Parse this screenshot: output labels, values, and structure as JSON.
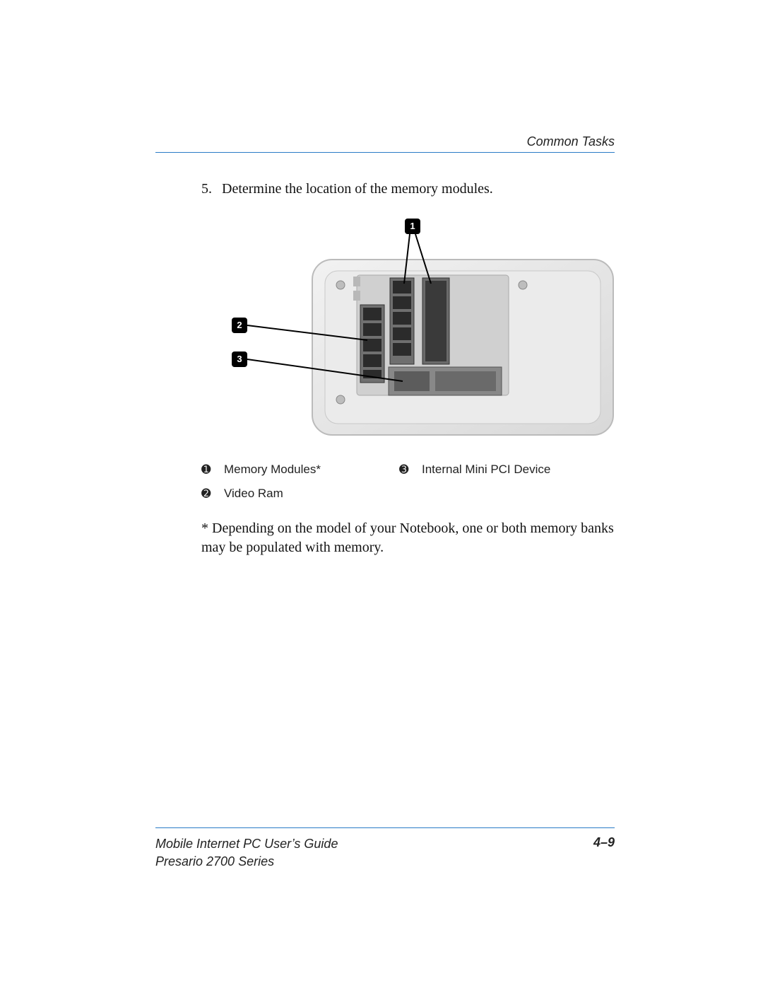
{
  "header": {
    "section": "Common Tasks"
  },
  "step": {
    "number": "5.",
    "text": "Determine the location of the memory modules."
  },
  "callouts": {
    "c1": "1",
    "c2": "2",
    "c3": "3"
  },
  "legend": {
    "n1": "➊",
    "l1": "Memory Modules*",
    "n2": "➋",
    "l2": "Video Ram",
    "n3": "➌",
    "l3": "Internal Mini PCI Device"
  },
  "footnote": "* Depending on the model of your Notebook, one or both memory banks may be populated with memory.",
  "footer": {
    "guide": "Mobile Internet PC User’s Guide",
    "series": "Presario 2700 Series",
    "page": "4–9"
  }
}
